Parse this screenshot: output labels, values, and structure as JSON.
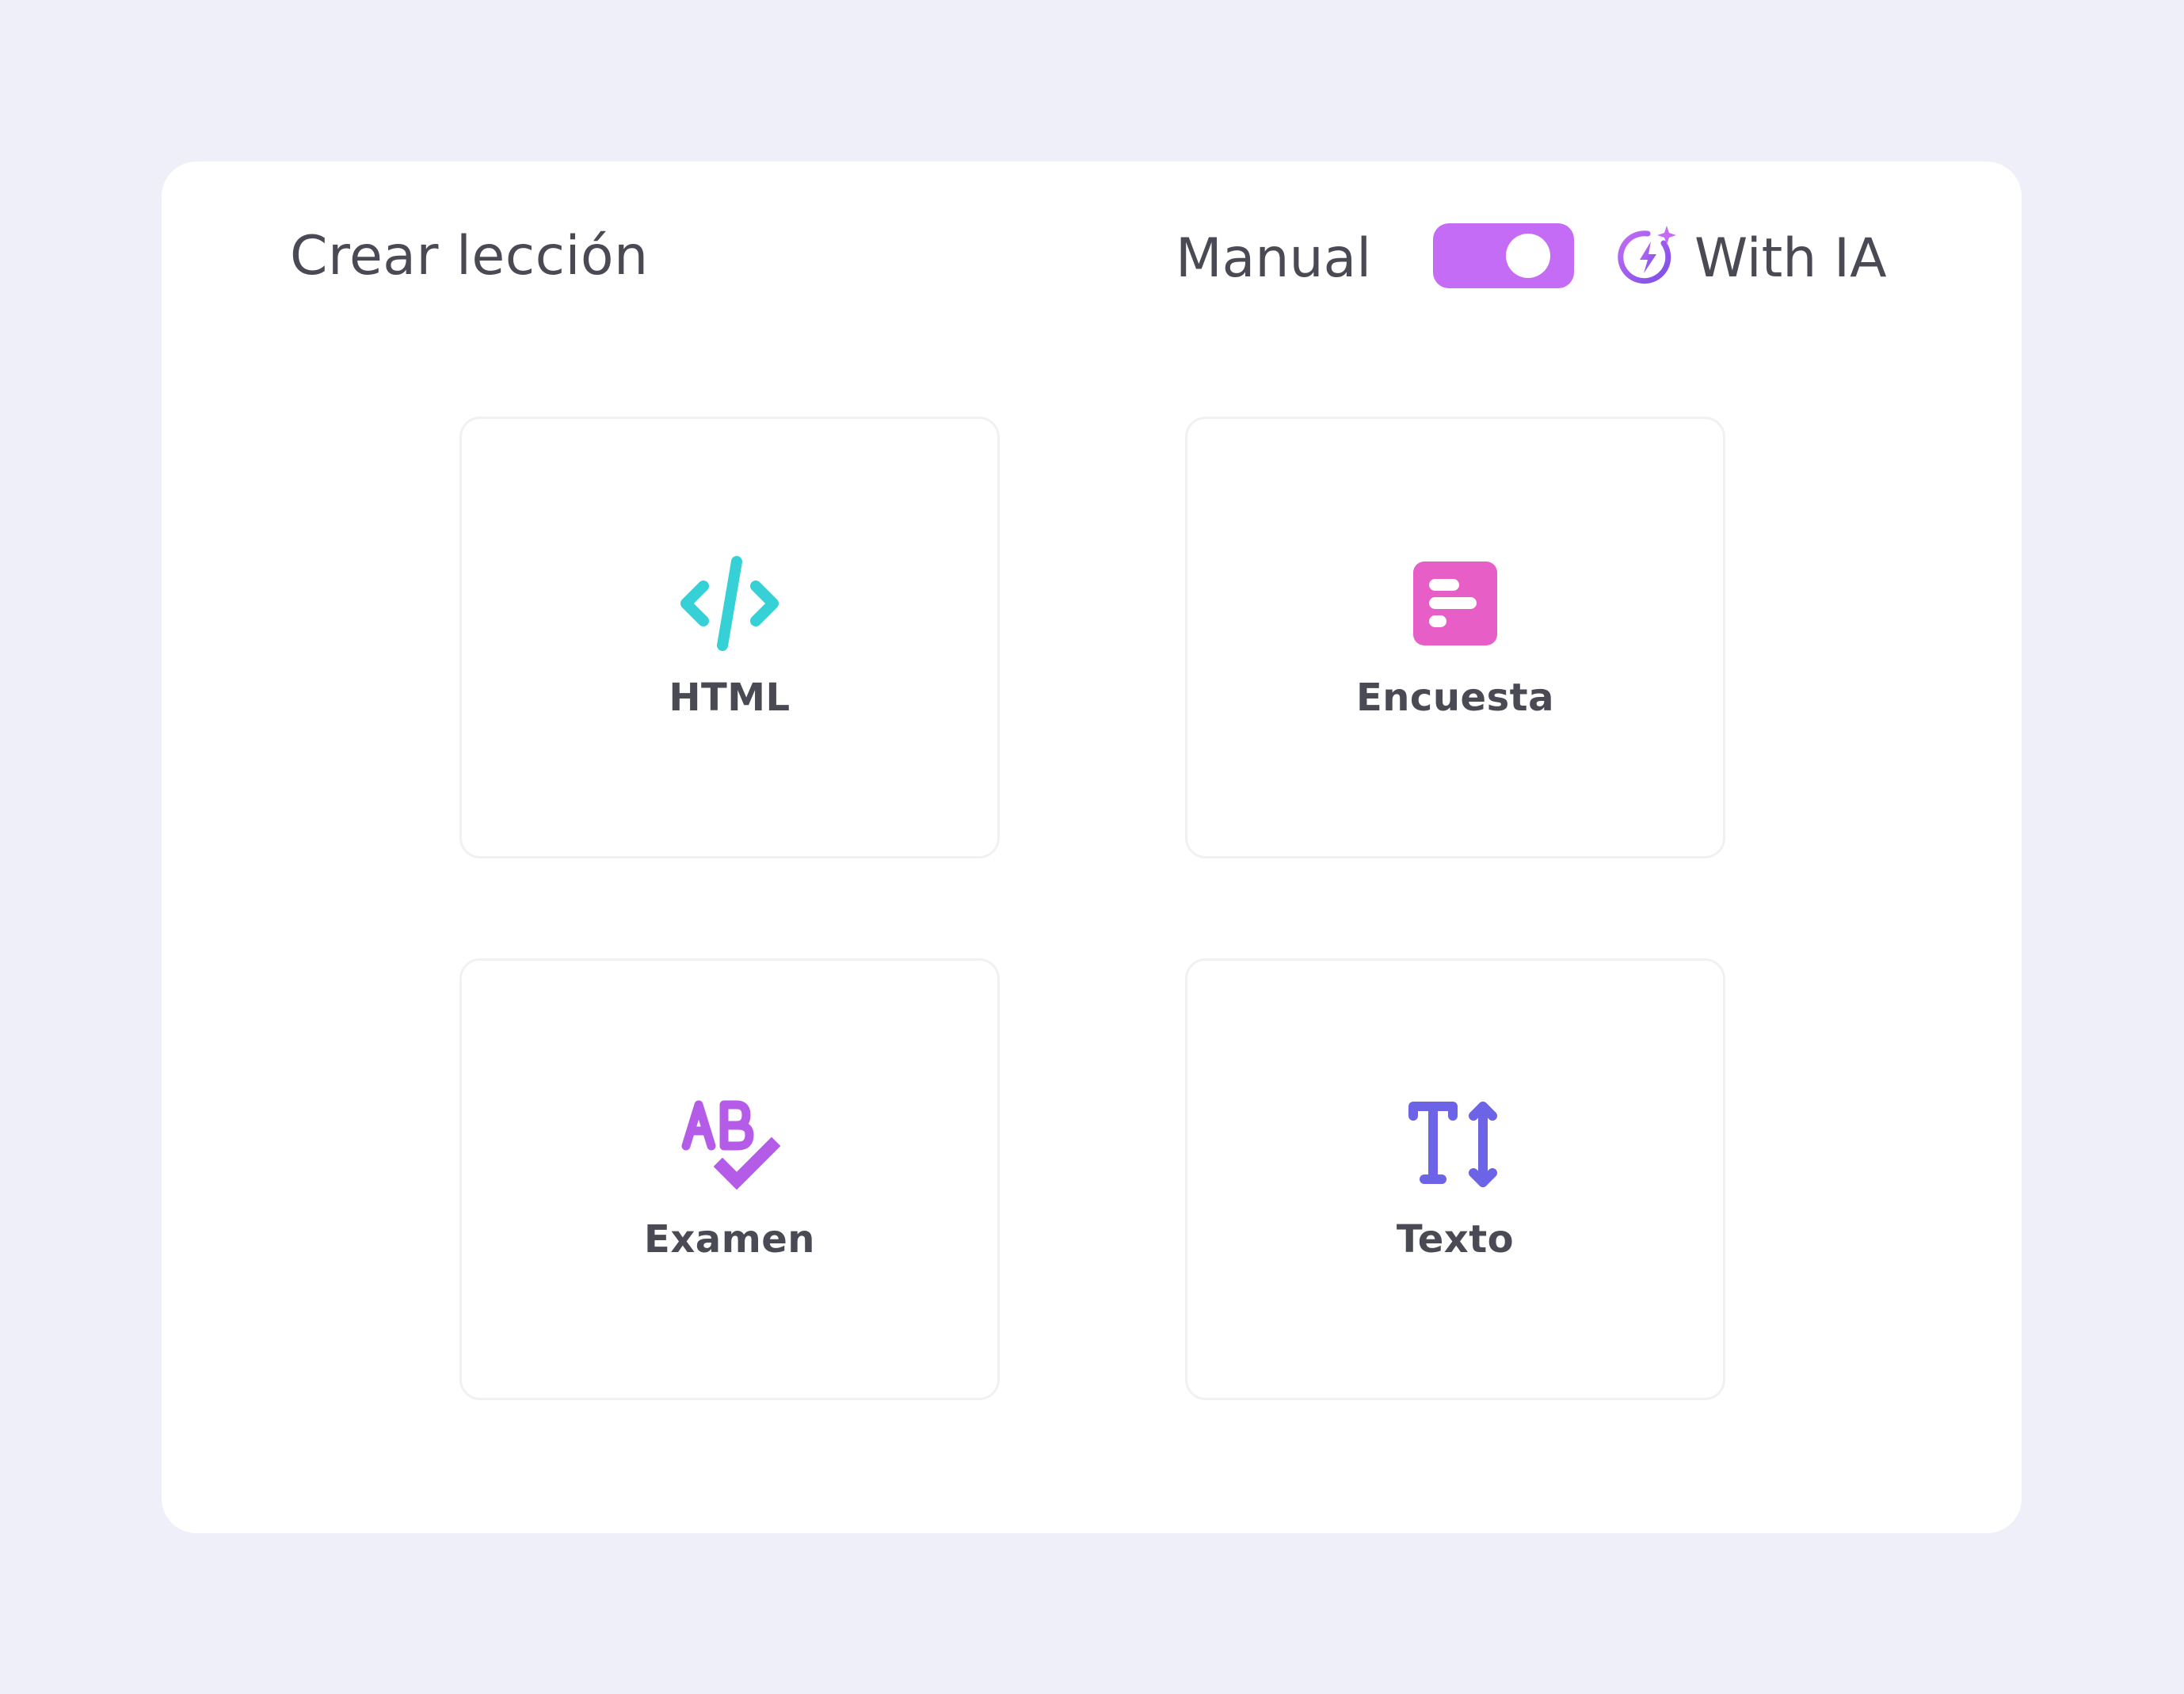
{
  "header": {
    "title": "Crear lección",
    "mode_manual_label": "Manual",
    "mode_ai_label": "With IA",
    "toggle_on": true
  },
  "icons": {
    "ai": "ai-lightning-sparkle-icon",
    "html": "code-icon",
    "survey": "survey-icon",
    "exam": "ab-check-icon",
    "text": "text-size-icon"
  },
  "lesson_types": [
    {
      "label": "HTML",
      "icon": "code-icon",
      "color": "#36D1D6"
    },
    {
      "label": "Encuesta",
      "icon": "survey-icon",
      "color": "#E65EC6"
    },
    {
      "label": "Examen",
      "icon": "ab-check-icon",
      "color": "#B45BE8"
    },
    {
      "label": "Texto",
      "icon": "text-size-icon",
      "color": "#6C63E6"
    }
  ],
  "colors": {
    "background": "#EFEFFA",
    "panel": "#FFFFFF",
    "toggle": "#C46CF5",
    "text": "#4A4A55",
    "ai_icon": "#9B55F0"
  }
}
